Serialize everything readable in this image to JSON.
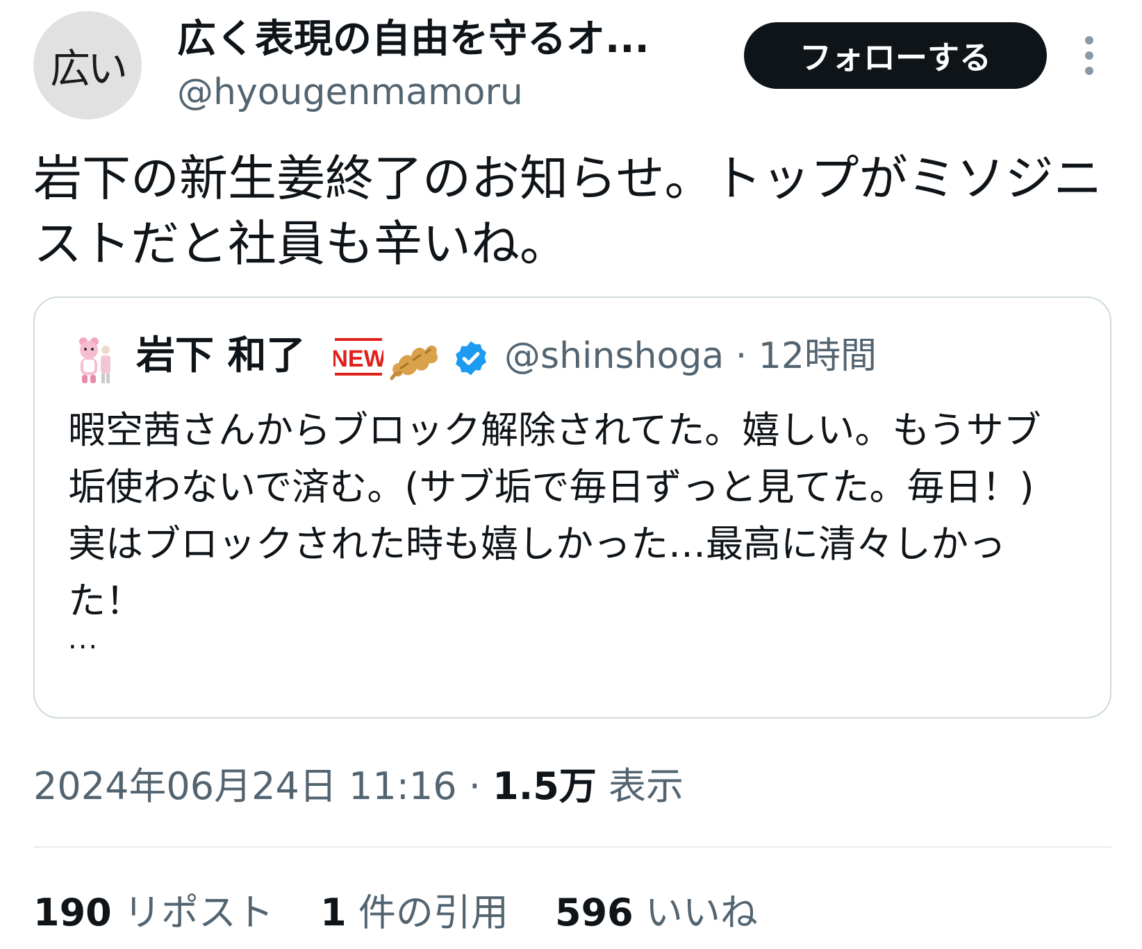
{
  "author": {
    "avatar_text": "広い",
    "display_name": "広く表現の自由を守るオ...",
    "handle": "@hyougenmamoru"
  },
  "follow_button_label": "フォローする",
  "tweet_text": "岩下の新生姜終了のお知らせ。トップがミソジニストだと社員も辛いね。",
  "quote": {
    "display_name": "岩下 和了",
    "badge_text": "NEW",
    "handle_time": "@shinshoga · 12時間",
    "text": "暇空茜さんからブロック解除されてた。嬉しい。もうサブ垢使わないで済む。(サブ垢で毎日ずっと見てた。毎日！)実はブロックされた時も嬉しかった…最高に清々しかった！",
    "ellipsis": "..."
  },
  "meta": {
    "timestamp": "2024年06月24日 11:16",
    "separator": " · ",
    "views_count": "1.5万",
    "views_label": " 表示"
  },
  "stats": {
    "reposts_count": "190",
    "reposts_label": " リポスト",
    "quotes_count": "1",
    "quotes_label": " 件の引用",
    "likes_count": "596",
    "likes_label": " いいね"
  },
  "colors": {
    "text_primary": "#0f1419",
    "text_secondary": "#536471",
    "border": "#cfd9de",
    "verified_blue": "#1d9bf0",
    "new_badge_red": "#e0201b"
  },
  "icons": [
    "more-vertical-icon",
    "verified-badge-icon",
    "new-badge-icon",
    "ginger-icon",
    "character-avatar-icon"
  ]
}
